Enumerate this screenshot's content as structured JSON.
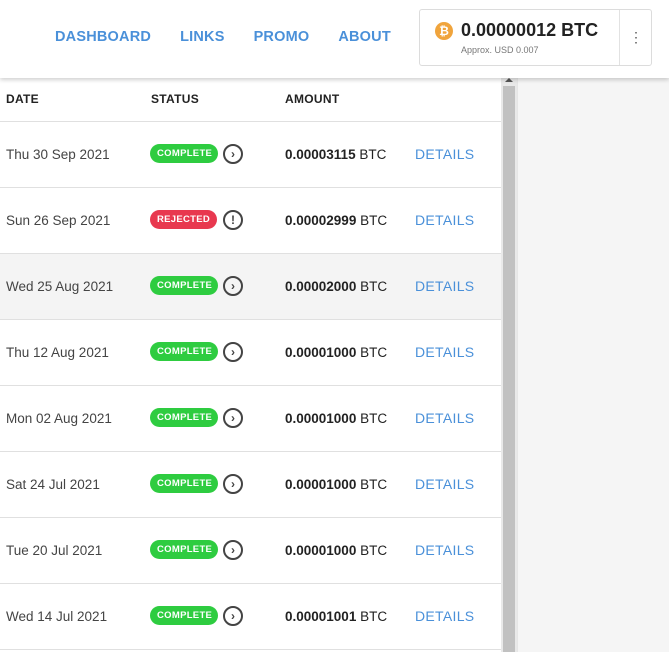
{
  "nav": {
    "items": [
      {
        "label": "DASHBOARD"
      },
      {
        "label": "LINKS"
      },
      {
        "label": "PROMO"
      },
      {
        "label": "ABOUT"
      }
    ]
  },
  "wallet": {
    "icon": "bitcoin-icon",
    "icon_glyph": "₿",
    "balance": "0.00000012 BTC",
    "approx": "Approx. USD 0.007",
    "menu_icon": "⋮"
  },
  "table": {
    "headers": {
      "date": "DATE",
      "status": "STATUS",
      "amount": "AMOUNT"
    },
    "rows": [
      {
        "date": "Thu 30 Sep 2021",
        "status": "COMPLETE",
        "status_icon": "chevron-right-circle-icon",
        "amount": "0.00003115 BTC",
        "action": "DETAILS"
      },
      {
        "date": "Sun 26 Sep 2021",
        "status": "REJECTED",
        "status_icon": "exclamation-circle-icon",
        "amount": "0.00002999 BTC",
        "action": "DETAILS"
      },
      {
        "date": "Wed 25 Aug 2021",
        "status": "COMPLETE",
        "status_icon": "chevron-right-circle-icon",
        "amount": "0.00002000 BTC",
        "action": "DETAILS"
      },
      {
        "date": "Thu 12 Aug 2021",
        "status": "COMPLETE",
        "status_icon": "chevron-right-circle-icon",
        "amount": "0.00001000 BTC",
        "action": "DETAILS"
      },
      {
        "date": "Mon 02 Aug 2021",
        "status": "COMPLETE",
        "status_icon": "chevron-right-circle-icon",
        "amount": "0.00001000 BTC",
        "action": "DETAILS"
      },
      {
        "date": "Sat 24 Jul 2021",
        "status": "COMPLETE",
        "status_icon": "chevron-right-circle-icon",
        "amount": "0.00001000 BTC",
        "action": "DETAILS"
      },
      {
        "date": "Tue 20 Jul 2021",
        "status": "COMPLETE",
        "status_icon": "chevron-right-circle-icon",
        "amount": "0.00001000 BTC",
        "action": "DETAILS"
      },
      {
        "date": "Wed 14 Jul 2021",
        "status": "COMPLETE",
        "status_icon": "chevron-right-circle-icon",
        "amount": "0.00001001 BTC",
        "action": "DETAILS"
      }
    ]
  },
  "colors": {
    "accent": "#4a90d9",
    "complete": "#2ecc40",
    "rejected": "#e8384f",
    "bitcoin": "#f0a43c"
  }
}
